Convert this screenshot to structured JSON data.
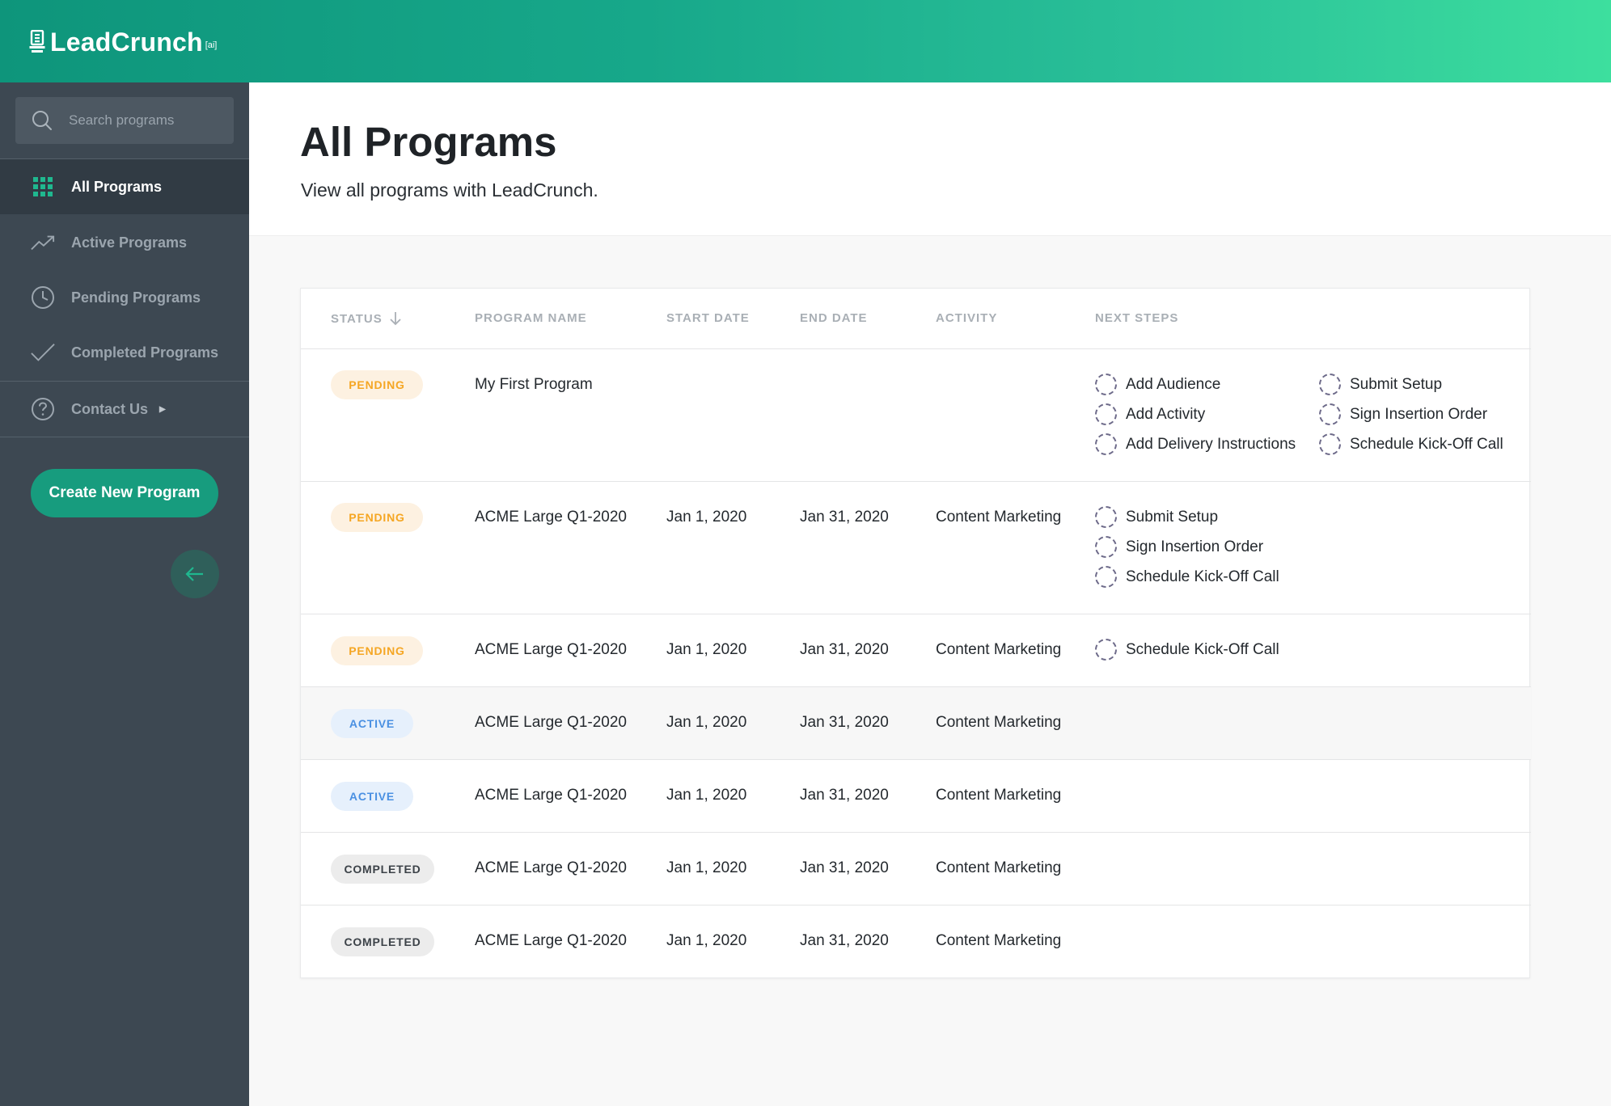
{
  "app": {
    "logo_text": "LeadCrunch",
    "logo_suffix": "[ai]"
  },
  "sidebar": {
    "search_placeholder": "Search programs",
    "items": [
      {
        "label": "All Programs",
        "icon": "grid-icon",
        "active": true
      },
      {
        "label": "Active Programs",
        "icon": "trending-up-icon",
        "active": false
      },
      {
        "label": "Pending Programs",
        "icon": "clock-icon",
        "active": false
      },
      {
        "label": "Completed Programs",
        "icon": "check-icon",
        "active": false
      },
      {
        "label": "Contact Us",
        "icon": "help-circle-icon",
        "active": false
      }
    ],
    "create_button": "Create New Program"
  },
  "page": {
    "title": "All Programs",
    "subtitle": "View all programs with LeadCrunch."
  },
  "table": {
    "headers": {
      "status": "STATUS",
      "program_name": "PROGRAM NAME",
      "start_date": "START DATE",
      "end_date": "END DATE",
      "activity": "ACTIVITY",
      "next_steps": "NEXT STEPS"
    },
    "rows": [
      {
        "status": "PENDING",
        "name": "My First Program",
        "start": "",
        "end": "",
        "activity": "",
        "steps": [
          "Add Audience",
          "Add Activity",
          "Add Delivery Instructions",
          "Submit Setup",
          "Sign Insertion Order",
          "Schedule Kick-Off Call"
        ]
      },
      {
        "status": "PENDING",
        "name": "ACME Large Q1-2020",
        "start": "Jan 1, 2020",
        "end": "Jan 31, 2020",
        "activity": "Content Marketing",
        "steps": [
          "Submit Setup",
          "Sign Insertion Order",
          "Schedule Kick-Off Call"
        ]
      },
      {
        "status": "PENDING",
        "name": "ACME Large Q1-2020",
        "start": "Jan 1, 2020",
        "end": "Jan 31, 2020",
        "activity": "Content Marketing",
        "steps": [
          "Schedule Kick-Off Call"
        ]
      },
      {
        "status": "ACTIVE",
        "name": "ACME Large Q1-2020",
        "start": "Jan 1, 2020",
        "end": "Jan 31, 2020",
        "activity": "Content Marketing",
        "steps": []
      },
      {
        "status": "ACTIVE",
        "name": "ACME Large Q1-2020",
        "start": "Jan 1, 2020",
        "end": "Jan 31, 2020",
        "activity": "Content Marketing",
        "steps": []
      },
      {
        "status": "COMPLETED",
        "name": "ACME Large Q1-2020",
        "start": "Jan 1, 2020",
        "end": "Jan 31, 2020",
        "activity": "Content Marketing",
        "steps": []
      },
      {
        "status": "COMPLETED",
        "name": "ACME Large Q1-2020",
        "start": "Jan 1, 2020",
        "end": "Jan 31, 2020",
        "activity": "Content Marketing",
        "steps": []
      }
    ]
  },
  "colors": {
    "brand_green": "#179c7e",
    "sidebar_bg": "#3d4852",
    "pending": "#f5a623",
    "active": "#4a90e2",
    "completed": "#3c4248"
  }
}
